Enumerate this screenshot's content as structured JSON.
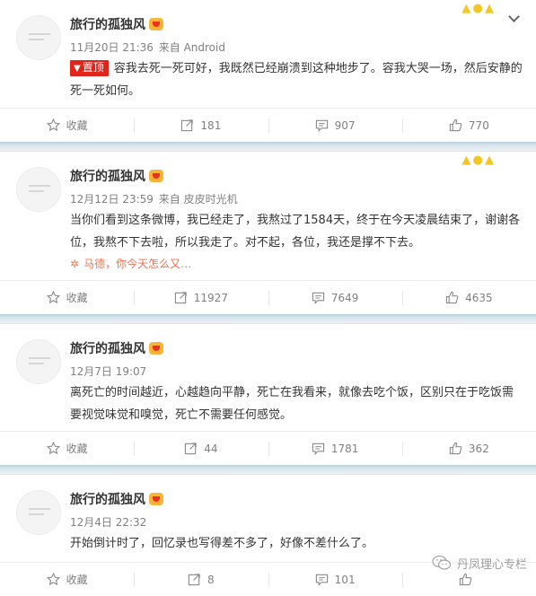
{
  "posts": [
    {
      "author": "旅行的孤独风",
      "date": "11月20日 21:36",
      "source": "来自 Android",
      "pinned_label": "置顶",
      "text": "容我去死一死可好，我既然已经崩溃到这种地步了。容我大哭一场，然后安静的死一死如何。",
      "repost_preview": "",
      "actions": {
        "favorite": "收藏",
        "reposts": "181",
        "comments": "907",
        "likes": "770"
      }
    },
    {
      "author": "旅行的孤独风",
      "date": "12月12日 23:59",
      "source": "来自 皮皮时光机",
      "pinned_label": "",
      "text": "当你们看到这条微博，我已经走了，我熬过了1584天，终于在今天凌晨结束了，谢谢各位，我熬不下去啦，所以我走了。对不起，各位，我还是撑不下去。",
      "repost_preview": "马德，你今天怎么又…",
      "actions": {
        "favorite": "收藏",
        "reposts": "11927",
        "comments": "7649",
        "likes": "4635"
      }
    },
    {
      "author": "旅行的孤独风",
      "date": "12月7日 19:07",
      "source": "",
      "pinned_label": "",
      "text": "离死亡的时间越近，心越趋向平静，死亡在我看来，就像去吃个饭，区别只在于吃饭需要视觉味觉和嗅觉，死亡不需要任何感觉。",
      "repost_preview": "",
      "actions": {
        "favorite": "收藏",
        "reposts": "44",
        "comments": "1781",
        "likes": "362"
      }
    },
    {
      "author": "旅行的孤独风",
      "date": "12月4日 22:32",
      "source": "",
      "pinned_label": "",
      "text": "开始倒计时了，回忆录也写得差不多了，好像不差什么了。",
      "repost_preview": "",
      "actions": {
        "favorite": "收藏",
        "reposts": "8",
        "comments": "101",
        "likes": ""
      }
    }
  ],
  "watermark": "丹凤理心专栏",
  "colors": {
    "pin_badge": "#e2231a",
    "repost_text": "#eb7350",
    "separator": "#d6e5ee",
    "crown": "#f3c623"
  }
}
